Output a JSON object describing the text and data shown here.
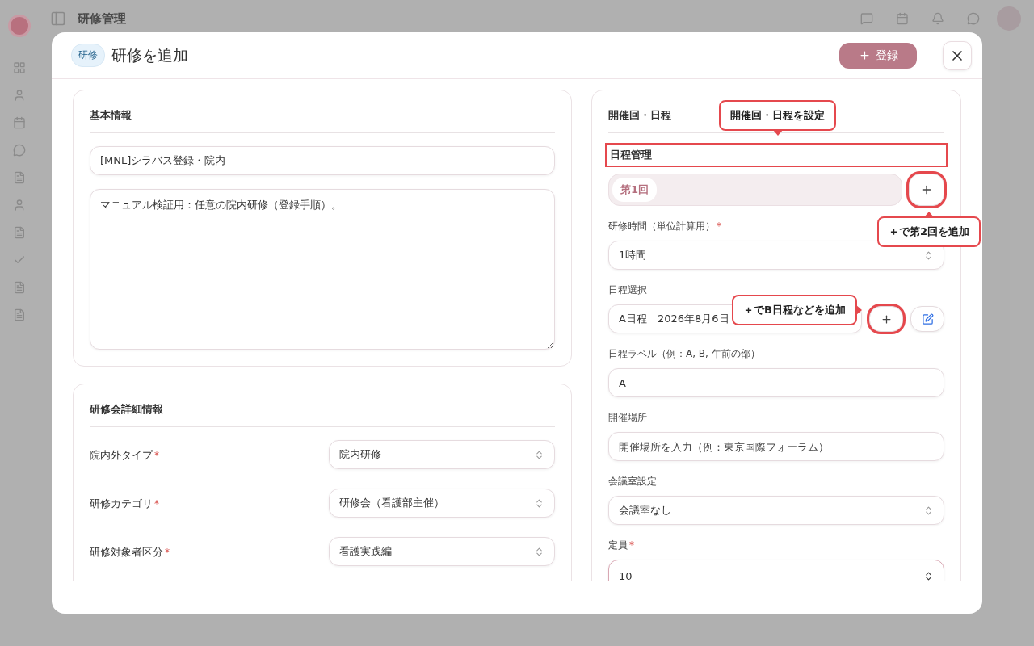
{
  "app": {
    "title": "研修管理"
  },
  "modal": {
    "badge": "研修",
    "title": "研修を追加",
    "submit_label": "登録"
  },
  "basic_info": {
    "heading": "基本情報",
    "name_value": "[MNL]シラバス登録・院内",
    "description_value": "マニュアル検証用：任意の院内研修（登録手順）。"
  },
  "details": {
    "heading": "研修会詳細情報",
    "rows": [
      {
        "label": "院内外タイプ",
        "required_mark": "*",
        "value": "院内研修"
      },
      {
        "label": "研修カテゴリ",
        "required_mark": "*",
        "value": "研修会（看護部主催）"
      },
      {
        "label": "研修対象者区分",
        "required_mark": "*",
        "value": "看護実践編"
      }
    ]
  },
  "schedule": {
    "heading": "開催回・日程",
    "section_title": {
      "text": "日程管理",
      "highlighted": true
    },
    "rounds": [
      {
        "label": "第1回",
        "selected": true
      }
    ],
    "add_round_highlighted": true,
    "fields": [
      {
        "kind": "select",
        "label": "研修時間（単位計算用）",
        "required_mark": "*",
        "value": "1時間"
      },
      {
        "kind": "date_select",
        "label": "日程選択",
        "value": "A日程　2026年8月6日",
        "add_highlighted": true
      },
      {
        "kind": "text",
        "label": "日程ラベル（例：A, B, 午前の部）",
        "value": "A"
      },
      {
        "kind": "text",
        "label": "開催場所",
        "placeholder": "開催場所を入力（例：東京国際フォーラム）"
      },
      {
        "kind": "select",
        "label": "会議室設定",
        "value": "会議室なし"
      },
      {
        "kind": "number",
        "label": "定員",
        "required_mark": "*",
        "value": "10"
      }
    ]
  },
  "callouts": [
    {
      "text": "開催回・日程を設定"
    },
    {
      "text": "＋で第2回を追加"
    },
    {
      "text": "＋でB日程などを追加"
    }
  ]
}
